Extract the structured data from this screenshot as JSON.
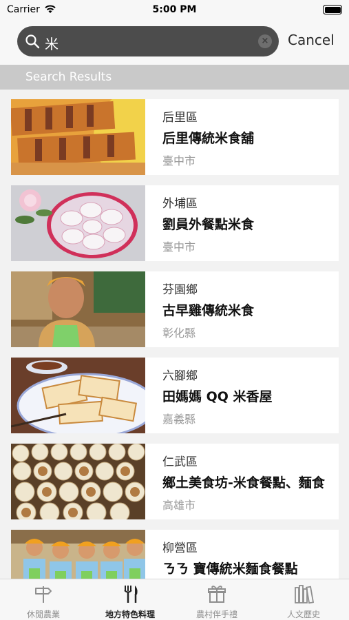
{
  "status_bar": {
    "carrier": "Carrier",
    "time": "5:00 PM"
  },
  "search": {
    "query": "米",
    "cancel_label": "Cancel"
  },
  "section": {
    "title": "Search Results"
  },
  "results": [
    {
      "district": "后里區",
      "name": "后里傳統米食舖",
      "city": "臺中市"
    },
    {
      "district": "外埔區",
      "name": "劉員外餐點米食",
      "city": "臺中市"
    },
    {
      "district": "芬園鄉",
      "name": "古早雞傳統米食",
      "city": "彰化縣"
    },
    {
      "district": "六腳鄉",
      "name": "田媽媽 QQ 米香屋",
      "city": "嘉義縣"
    },
    {
      "district": "仁武區",
      "name": "鄉土美食坊-米食餐點、麵食",
      "city": "高雄市"
    },
    {
      "district": "柳營區",
      "name": "ㄋㄋ 寶傳統米麵食餐點",
      "city": ""
    }
  ],
  "tabs": [
    {
      "label": "休閒農業",
      "icon": "signpost-icon",
      "active": false
    },
    {
      "label": "地方特色料理",
      "icon": "fork-knife-icon",
      "active": true
    },
    {
      "label": "農村伴手禮",
      "icon": "gift-icon",
      "active": false
    },
    {
      "label": "人文歷史",
      "icon": "books-icon",
      "active": false
    }
  ],
  "colors": {
    "search_bg": "#4c4c4c",
    "section_header_bg": "#c9c9c9",
    "active_tab": "#222222",
    "inactive_tab": "#8e8e8e"
  }
}
